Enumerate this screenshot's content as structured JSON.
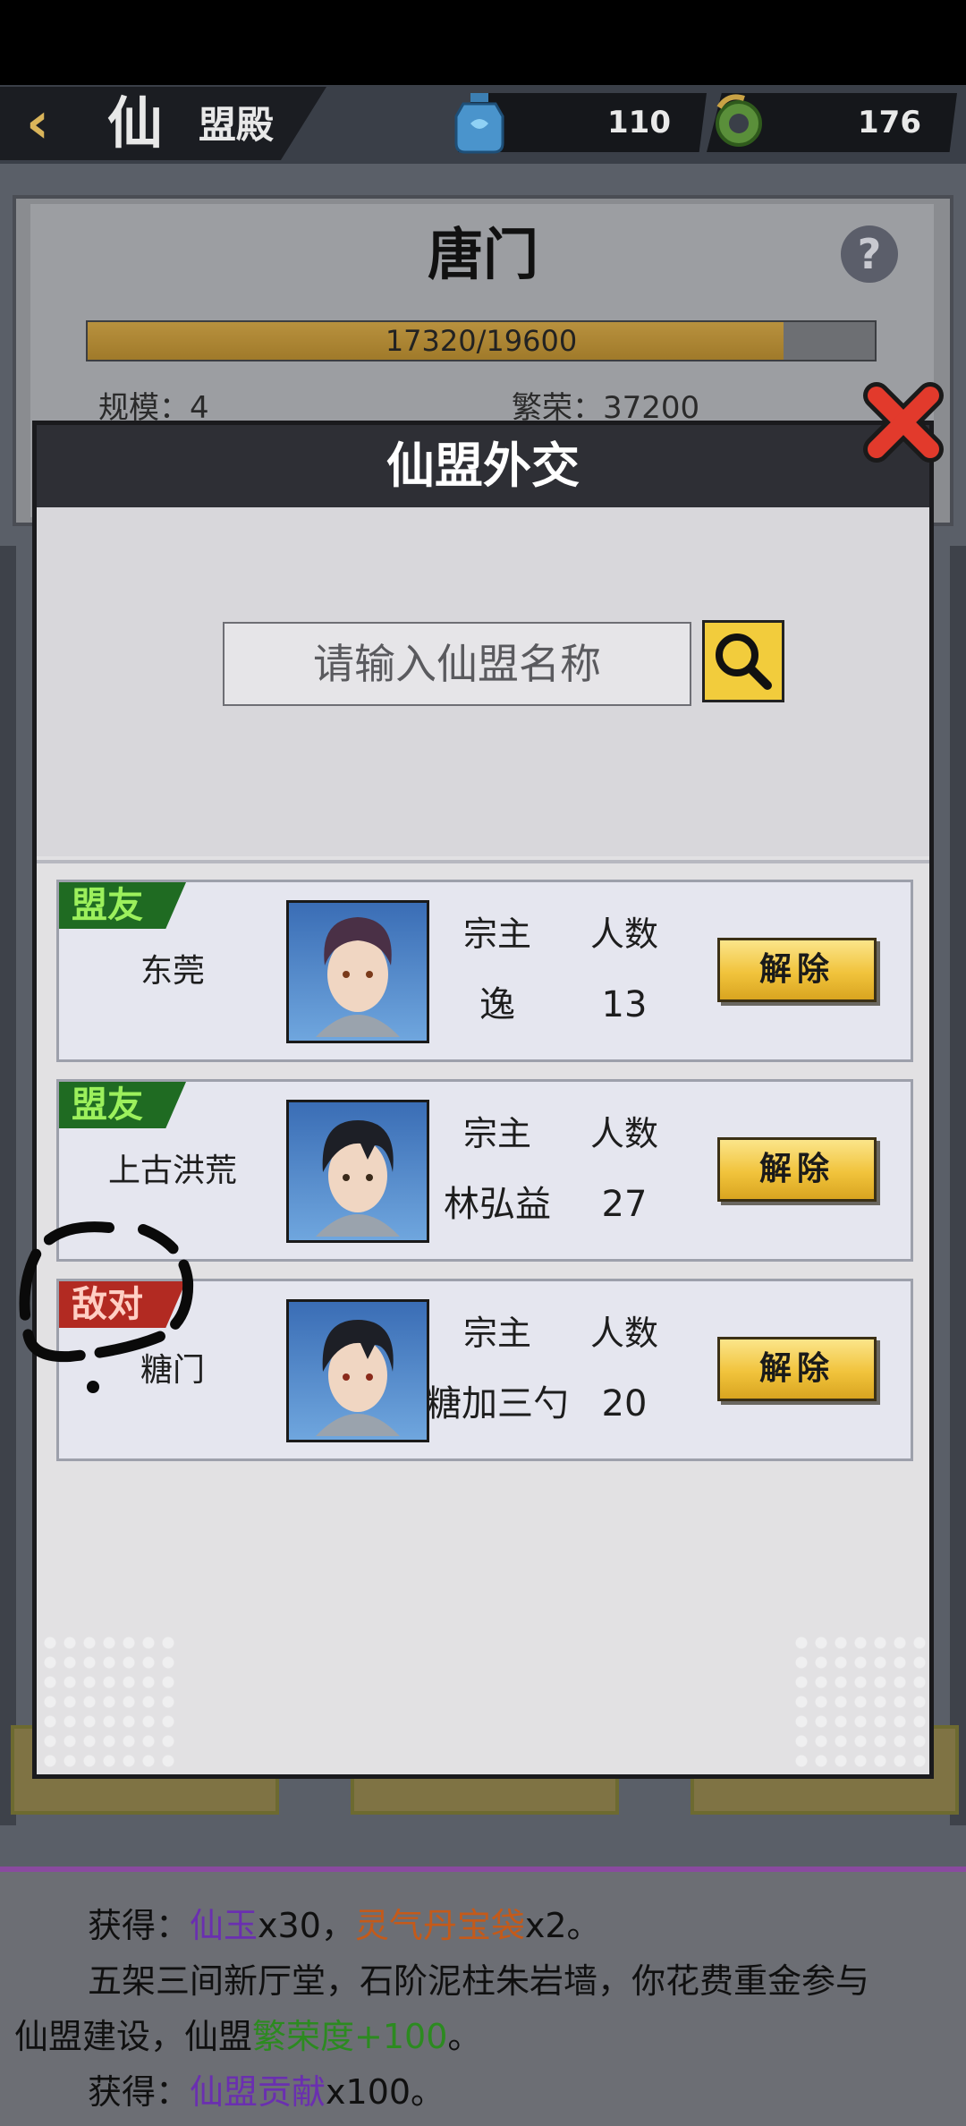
{
  "header": {
    "back_icon": "chevron-left-icon",
    "title_main": "仙",
    "title_rest": "盟殿",
    "resources": [
      {
        "icon": "jade-bottle-icon",
        "value": "110"
      },
      {
        "icon": "dragon-coin-icon",
        "value": "176"
      }
    ]
  },
  "guild_panel": {
    "name": "唐门",
    "progress_text": "17320/19600",
    "progress_fraction": 0.884,
    "scale_text": "规模：4",
    "prosperity_text": "繁荣：37200"
  },
  "modal": {
    "title": "仙盟外交",
    "search_placeholder": "请输入仙盟名称",
    "col_leader_label": "宗主",
    "col_members_label": "人数",
    "release_label": "解除",
    "relations": [
      {
        "tag": "盟友",
        "kind": "ally",
        "guild_name": "东莞",
        "leader": "逸",
        "members": "13"
      },
      {
        "tag": "盟友",
        "kind": "ally",
        "guild_name": "上古洪荒",
        "leader": "林弘益",
        "members": "27"
      },
      {
        "tag": "敌对",
        "kind": "enemy",
        "guild_name": "糖门",
        "leader": "糖加三勺",
        "members": "20"
      }
    ]
  },
  "log": {
    "line1_prefix": "获得：",
    "line1_item1": "仙玉",
    "line1_qty1": "x30，",
    "line1_item2": "灵气丹宝袋",
    "line1_qty2": "x2。",
    "line2": "五架三间新厅堂，石阶泥柱朱岩墙，你花费重金参与",
    "line3_prefix": "仙盟建设，仙盟",
    "line3_stat": "繁荣度+100",
    "line3_suffix": "。",
    "line4_prefix": "获得：",
    "line4_item": "仙盟贡献",
    "line4_qty": "x100。"
  },
  "colors": {
    "ally_tag": "#1f6b22",
    "enemy_tag": "#b22a22",
    "button_gold": "#f1c33c",
    "close_red": "#e23a2c"
  }
}
